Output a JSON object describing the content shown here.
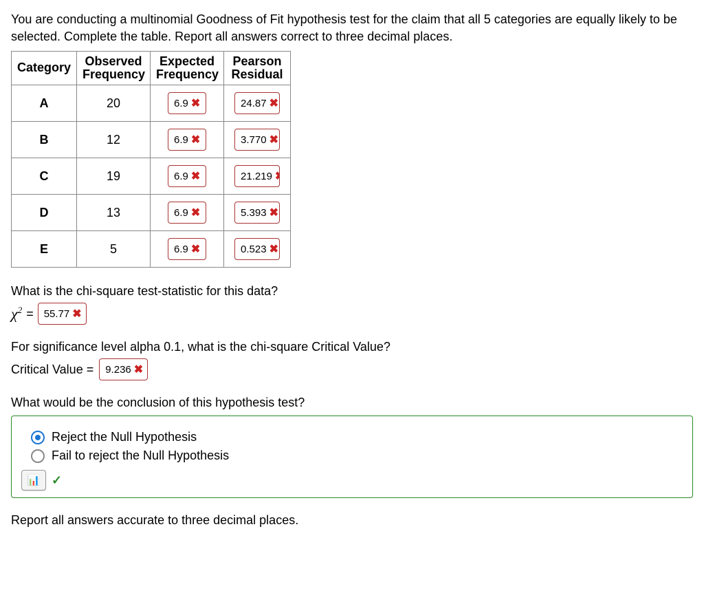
{
  "instruction": "You are conducting a multinomial Goodness of Fit hypothesis test for the claim that all 5 categories are equally likely to be selected. Complete the table. Report all answers correct to three decimal places.",
  "table": {
    "headers": {
      "category": "Category",
      "observed": "Observed Frequency",
      "expected": "Expected Frequency",
      "residual": "Pearson Residual"
    },
    "rows": [
      {
        "cat": "A",
        "obs": "20",
        "expected": "6.9",
        "expected_wrong": true,
        "residual": "24.87",
        "residual_wrong": true
      },
      {
        "cat": "B",
        "obs": "12",
        "expected": "6.9",
        "expected_wrong": true,
        "residual": "3.770",
        "residual_wrong": true
      },
      {
        "cat": "C",
        "obs": "19",
        "expected": "6.9",
        "expected_wrong": true,
        "residual": "21.219",
        "residual_wrong": true
      },
      {
        "cat": "D",
        "obs": "13",
        "expected": "6.9",
        "expected_wrong": true,
        "residual": "5.393",
        "residual_wrong": true
      },
      {
        "cat": "E",
        "obs": "5",
        "expected": "6.9",
        "expected_wrong": true,
        "residual": "0.523",
        "residual_wrong": true
      }
    ]
  },
  "chi_q": "What is the chi-square test-statistic for this data?",
  "chi_symbol": "χ",
  "chi_exp": "2",
  "equals": "=",
  "chi_value": "55.77",
  "chi_wrong": true,
  "crit_q": "For significance level alpha 0.1, what is the chi-square Critical Value?",
  "crit_label": "Critical Value =",
  "crit_value": "9.236",
  "crit_wrong": true,
  "concl_q": "What would be the conclusion of this hypothesis test?",
  "options": [
    {
      "label": "Reject the Null Hypothesis",
      "selected": true
    },
    {
      "label": "Fail to reject the Null Hypothesis",
      "selected": false
    }
  ],
  "concl_correct": true,
  "footer": "Report all answers accurate to three decimal places.",
  "icons": {
    "wrong": "✖",
    "correct": "✓",
    "calc": "📊"
  }
}
